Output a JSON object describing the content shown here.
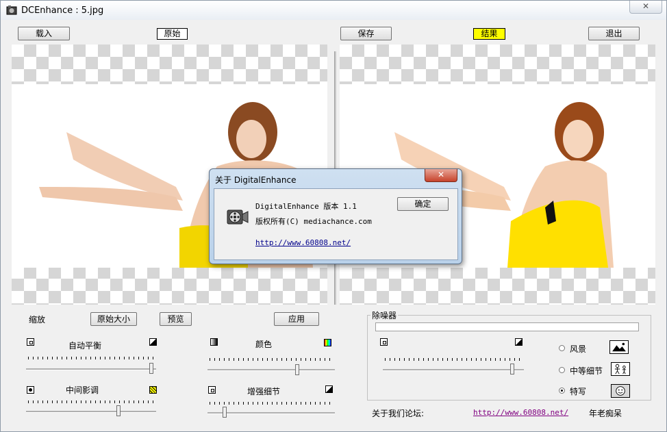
{
  "window": {
    "title": "DCEnhance : 5.jpg",
    "close_glyph": "✕"
  },
  "toolbar": {
    "load_label": "载入",
    "original_label": "原始",
    "save_label": "保存",
    "result_label": "结果",
    "exit_label": "退出"
  },
  "controls": {
    "zoom_label": "缩放",
    "original_size_label": "原始大小",
    "preview_label": "预览",
    "apply_label": "应用",
    "auto_balance_label": "自动平衡",
    "color_label": "颜色",
    "midtone_label": "中间影调",
    "enhance_detail_label": "增强细节",
    "auto_balance_value": 0.98,
    "color_value": 0.71,
    "midtone_value": 0.72,
    "enhance_detail_value": 0.12
  },
  "denoise": {
    "group_label": "除噪器",
    "slider_value": 0.93,
    "options": [
      {
        "label": "风景",
        "selected": false,
        "icon": "landscape-icon"
      },
      {
        "label": "中等细节",
        "selected": false,
        "icon": "people-icon"
      },
      {
        "label": "特写",
        "selected": true,
        "icon": "face-icon"
      }
    ]
  },
  "footer": {
    "forum_label": "关于我们论坛:",
    "forum_url": "http://www.60808.net/",
    "author_label": "年老痴呆"
  },
  "dialog": {
    "title": "关于 DigitalEnhance",
    "close_glyph": "✕",
    "version_text": "DigitalEnhance 版本 1.1",
    "copyright_text": "版权所有(C) mediachance.com",
    "link_text": "http://www.60808.net/",
    "ok_label": "确定"
  },
  "colors": {
    "result_badge": "#ffff00",
    "link": "#800080"
  }
}
